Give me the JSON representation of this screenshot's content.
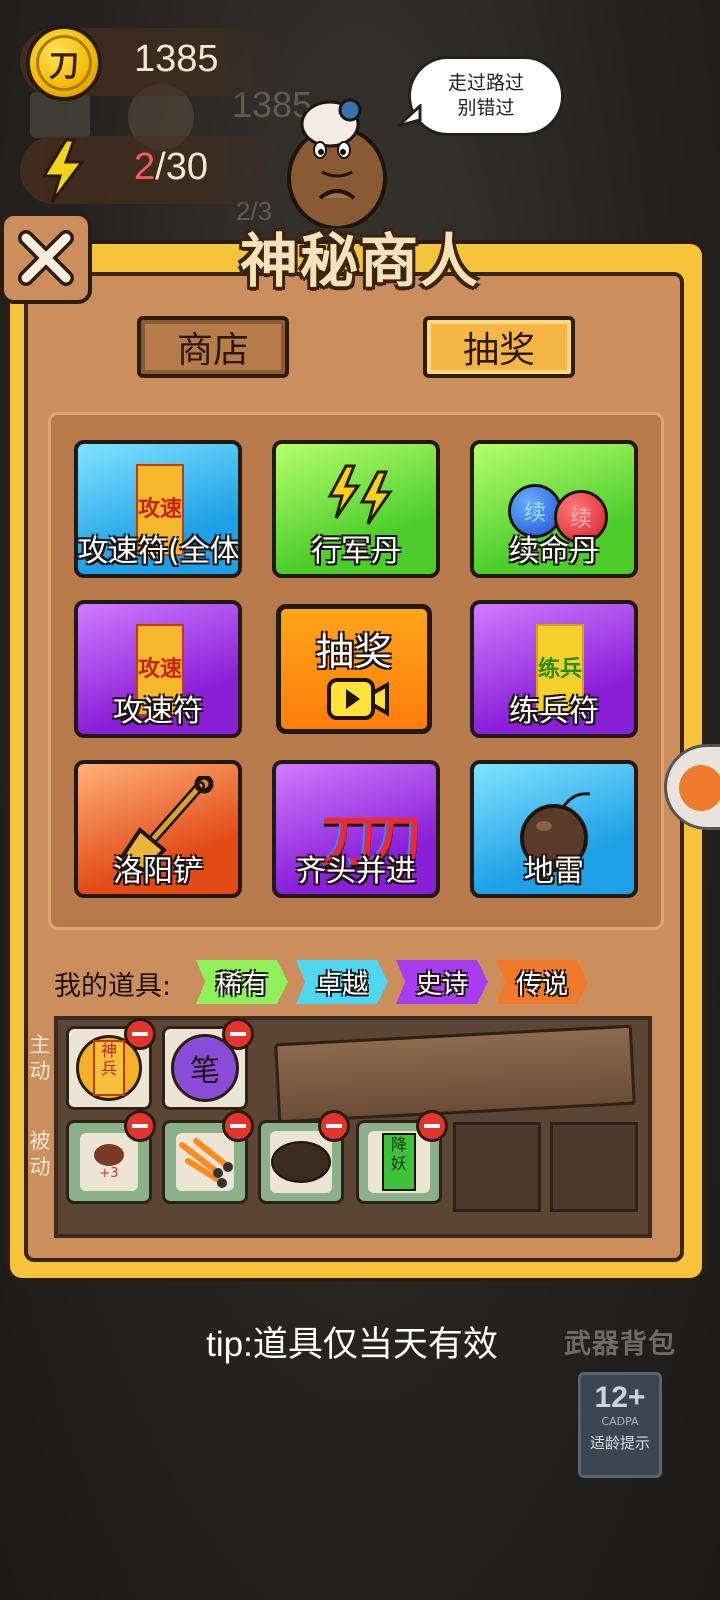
{
  "hud": {
    "coins": "1385",
    "energy_current": "2",
    "energy_max": "/30",
    "coin_glyph": "刀",
    "ghost_coins": "1385",
    "ghost_energy": "2/3"
  },
  "merchant": {
    "speech_line1": "走过路过",
    "speech_line2": "别错过",
    "title": "神秘商人"
  },
  "tabs": {
    "shop": "商店",
    "lottery": "抽奖"
  },
  "grid": {
    "items": [
      {
        "label": "攻速符(全体",
        "bg": "blue",
        "icon": "talisman-icon",
        "icon_text": "攻速"
      },
      {
        "label": "行军丹",
        "bg": "green",
        "icon": "lightning-pill-icon"
      },
      {
        "label": "续命丹",
        "bg": "green",
        "icon": "life-pill-icon",
        "icon_text": "续"
      },
      {
        "label": "攻速符",
        "bg": "purple",
        "icon": "talisman-icon",
        "icon_text": "攻速"
      },
      {
        "label": "抽奖",
        "bg": "orange",
        "icon": "video-icon"
      },
      {
        "label": "练兵符",
        "bg": "purple",
        "icon": "talisman-icon",
        "icon_text": "练兵"
      },
      {
        "label": "洛阳铲",
        "bg": "orange",
        "icon": "shovel-icon"
      },
      {
        "label": "齐头并进",
        "bg": "purple",
        "icon": "double-blade-icon",
        "icon_text": "刀刀"
      },
      {
        "label": "地雷",
        "bg": "blue",
        "icon": "bomb-icon"
      }
    ]
  },
  "inventory": {
    "title": "我的道具:",
    "rarities": [
      {
        "label": "稀有",
        "color": "#8ef05a"
      },
      {
        "label": "卓越",
        "color": "#4fd6f0"
      },
      {
        "label": "史诗",
        "color": "#a93cf0"
      },
      {
        "label": "传说",
        "color": "#f07a2c"
      }
    ],
    "active_label_1": "主",
    "active_label_2": "动",
    "passive_label_1": "被",
    "passive_label_2": "动",
    "active_items": [
      {
        "icon": "talisman-icon",
        "text": "神兵"
      },
      {
        "icon": "brush-icon",
        "text": "笔"
      }
    ],
    "passive_items": [
      {
        "icon": "meat-icon",
        "text": "+3"
      },
      {
        "icon": "arrows-icon"
      },
      {
        "icon": "rock-icon"
      },
      {
        "icon": "talisman-icon",
        "text": "降妖"
      }
    ]
  },
  "footer": {
    "tip": "tip:道具仅当天有效",
    "weapon_bag": "武器背包",
    "age_rating": "12+",
    "age_org": "CADPA",
    "age_hint": "适龄提示"
  }
}
